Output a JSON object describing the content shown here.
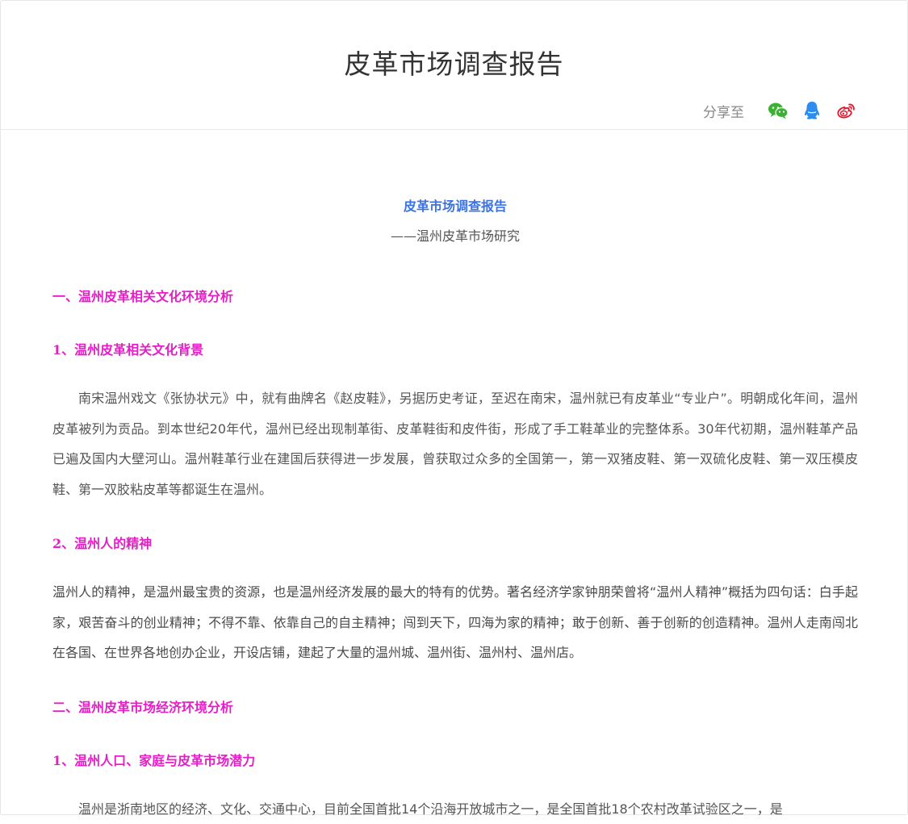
{
  "page": {
    "title": "皮革市场调查报告"
  },
  "share": {
    "label": "分享至",
    "icons": [
      "wechat-icon",
      "qq-icon",
      "weibo-icon"
    ]
  },
  "article": {
    "title": "皮革市场调查报告",
    "subtitle": "——温州皮革市场研究",
    "section1_heading": "一、温州皮革相关文化环境分析",
    "section1_1_heading": "1、温州皮革相关文化背景",
    "section1_1_para": "南宋温州戏文《张协状元》中，就有曲牌名《赵皮鞋》，另据历史考证，至迟在南宋，温州就已有皮革业“专业户”。明朝成化年间，温州皮革被列为贡品。到本世纪20年代，温州已经出现制革街、皮革鞋街和皮件街，形成了手工鞋革业的完整体系。30年代初期，温州鞋革产品已遍及国内大壁河山。温州鞋革行业在建国后获得进一步发展，曾获取过众多的全国第一，第一双猪皮鞋、第一双硫化皮鞋、第一双压模皮鞋、第一双胶粘皮革等都诞生在温州。",
    "section1_2_heading": "2、温州人的精神",
    "section1_2_para": "温州人的精神，是温州最宝贵的资源，也是温州经济发展的最大的特有的优势。著名经济学家钟朋荣曾将“温州人精神”概括为四句话：白手起家，艰苦奋斗的创业精神；不得不靠、依靠自己的自主精神；闯到天下，四海为家的精神；敢于创新、善于创新的创造精神。温州人走南闯北在各国、在世界各地创办企业，开设店铺，建起了大量的温州城、温州街、温州村、温州店。",
    "section2_heading": "二、温州皮革市场经济环境分析",
    "section2_1_heading": "1、温州人口、家庭与皮革市场潜力",
    "section2_1_para": "温州是浙南地区的经济、文化、交通中心，目前全国首批14个沿海开放城市之一，是全国首批18个农村改革试验区之一，是"
  },
  "colors": {
    "doc_title": "#3b73e6",
    "heading": "#e61ec8",
    "wechat": "#3cb034",
    "qq": "#2d8cf0",
    "weibo": "#e6162d"
  }
}
